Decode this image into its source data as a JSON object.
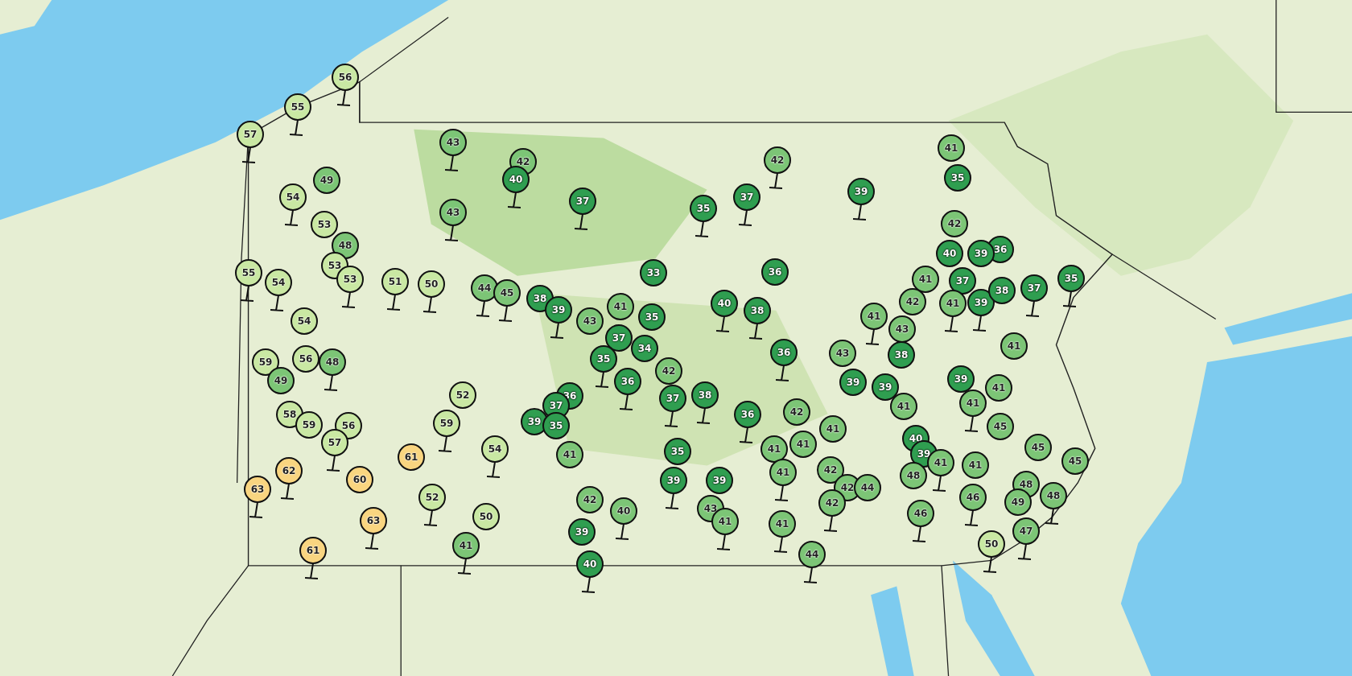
{
  "map": {
    "stations": [
      {
        "temperature": "56",
        "color": "#c9e8a3"
      },
      {
        "temperature": "55",
        "color": "#c9e8a3"
      },
      {
        "temperature": "57",
        "color": "#c9e8a3"
      },
      {
        "temperature": "43",
        "color": "#7cc576"
      },
      {
        "temperature": "42",
        "color": "#7cc576"
      },
      {
        "temperature": "40",
        "color": "#2f9e50"
      },
      {
        "temperature": "37",
        "color": "#2f9e50"
      },
      {
        "temperature": "49",
        "color": "#7cc576"
      },
      {
        "temperature": "54",
        "color": "#c9e8a3"
      },
      {
        "temperature": "43",
        "color": "#7cc576"
      },
      {
        "temperature": "53",
        "color": "#c9e8a3"
      },
      {
        "temperature": "48",
        "color": "#7cc576"
      },
      {
        "temperature": "53",
        "color": "#c9e8a3"
      },
      {
        "temperature": "53",
        "color": "#c9e8a3"
      },
      {
        "temperature": "55",
        "color": "#c9e8a3"
      },
      {
        "temperature": "54",
        "color": "#c9e8a3"
      },
      {
        "temperature": "51",
        "color": "#c9e8a3"
      },
      {
        "temperature": "50",
        "color": "#c9e8a3"
      },
      {
        "temperature": "44",
        "color": "#7cc576"
      },
      {
        "temperature": "45",
        "color": "#7cc576"
      },
      {
        "temperature": "38",
        "color": "#2f9e50"
      },
      {
        "temperature": "39",
        "color": "#2f9e50"
      },
      {
        "temperature": "54",
        "color": "#c9e8a3"
      },
      {
        "temperature": "59",
        "color": "#c9e8a3"
      },
      {
        "temperature": "56",
        "color": "#c9e8a3"
      },
      {
        "temperature": "48",
        "color": "#7cc576"
      },
      {
        "temperature": "49",
        "color": "#7cc576"
      },
      {
        "temperature": "52",
        "color": "#c9e8a3"
      },
      {
        "temperature": "59",
        "color": "#c9e8a3"
      },
      {
        "temperature": "58",
        "color": "#c9e8a3"
      },
      {
        "temperature": "59",
        "color": "#c9e8a3"
      },
      {
        "temperature": "56",
        "color": "#c9e8a3"
      },
      {
        "temperature": "57",
        "color": "#c9e8a3"
      },
      {
        "temperature": "61",
        "color": "#f9d580"
      },
      {
        "temperature": "54",
        "color": "#c9e8a3"
      },
      {
        "temperature": "62",
        "color": "#f9d580"
      },
      {
        "temperature": "63",
        "color": "#f9d580"
      },
      {
        "temperature": "60",
        "color": "#f9d580"
      },
      {
        "temperature": "52",
        "color": "#c9e8a3"
      },
      {
        "temperature": "50",
        "color": "#c9e8a3"
      },
      {
        "temperature": "63",
        "color": "#f9d580"
      },
      {
        "temperature": "41",
        "color": "#7cc576"
      },
      {
        "temperature": "61",
        "color": "#f9d580"
      },
      {
        "temperature": "35",
        "color": "#2f9e50"
      },
      {
        "temperature": "37",
        "color": "#2f9e50"
      },
      {
        "temperature": "42",
        "color": "#7cc576"
      },
      {
        "temperature": "39",
        "color": "#2f9e50"
      },
      {
        "temperature": "41",
        "color": "#7cc576"
      },
      {
        "temperature": "35",
        "color": "#2f9e50"
      },
      {
        "temperature": "42",
        "color": "#7cc576"
      },
      {
        "temperature": "36",
        "color": "#2f9e50"
      },
      {
        "temperature": "40",
        "color": "#2f9e50"
      },
      {
        "temperature": "39",
        "color": "#2f9e50"
      },
      {
        "temperature": "41",
        "color": "#7cc576"
      },
      {
        "temperature": "37",
        "color": "#2f9e50"
      },
      {
        "temperature": "41",
        "color": "#7cc576"
      },
      {
        "temperature": "39",
        "color": "#2f9e50"
      },
      {
        "temperature": "38",
        "color": "#2f9e50"
      },
      {
        "temperature": "37",
        "color": "#2f9e50"
      },
      {
        "temperature": "35",
        "color": "#2f9e50"
      },
      {
        "temperature": "33",
        "color": "#2f9e50"
      },
      {
        "temperature": "36",
        "color": "#2f9e50"
      },
      {
        "temperature": "43",
        "color": "#7cc576"
      },
      {
        "temperature": "41",
        "color": "#7cc576"
      },
      {
        "temperature": "35",
        "color": "#2f9e50"
      },
      {
        "temperature": "37",
        "color": "#2f9e50"
      },
      {
        "temperature": "34",
        "color": "#2f9e50"
      },
      {
        "temperature": "35",
        "color": "#2f9e50"
      },
      {
        "temperature": "36",
        "color": "#2f9e50"
      },
      {
        "temperature": "42",
        "color": "#7cc576"
      },
      {
        "temperature": "37",
        "color": "#2f9e50"
      },
      {
        "temperature": "38",
        "color": "#2f9e50"
      },
      {
        "temperature": "40",
        "color": "#2f9e50"
      },
      {
        "temperature": "38",
        "color": "#2f9e50"
      },
      {
        "temperature": "36",
        "color": "#2f9e50"
      },
      {
        "temperature": "43",
        "color": "#7cc576"
      },
      {
        "temperature": "41",
        "color": "#7cc576"
      },
      {
        "temperature": "42",
        "color": "#7cc576"
      },
      {
        "temperature": "43",
        "color": "#7cc576"
      },
      {
        "temperature": "38",
        "color": "#2f9e50"
      },
      {
        "temperature": "39",
        "color": "#2f9e50"
      },
      {
        "temperature": "39",
        "color": "#2f9e50"
      },
      {
        "temperature": "41",
        "color": "#7cc576"
      },
      {
        "temperature": "41",
        "color": "#7cc576"
      },
      {
        "temperature": "36",
        "color": "#2f9e50"
      },
      {
        "temperature": "37",
        "color": "#2f9e50"
      },
      {
        "temperature": "39",
        "color": "#2f9e50"
      },
      {
        "temperature": "35",
        "color": "#2f9e50"
      },
      {
        "temperature": "41",
        "color": "#7cc576"
      },
      {
        "temperature": "36",
        "color": "#2f9e50"
      },
      {
        "temperature": "42",
        "color": "#7cc576"
      },
      {
        "temperature": "41",
        "color": "#7cc576"
      },
      {
        "temperature": "41",
        "color": "#7cc576"
      },
      {
        "temperature": "41",
        "color": "#7cc576"
      },
      {
        "temperature": "41",
        "color": "#7cc576"
      },
      {
        "temperature": "42",
        "color": "#7cc576"
      },
      {
        "temperature": "42",
        "color": "#7cc576"
      },
      {
        "temperature": "44",
        "color": "#7cc576"
      },
      {
        "temperature": "42",
        "color": "#7cc576"
      },
      {
        "temperature": "35",
        "color": "#2f9e50"
      },
      {
        "temperature": "39",
        "color": "#2f9e50"
      },
      {
        "temperature": "39",
        "color": "#2f9e50"
      },
      {
        "temperature": "43",
        "color": "#7cc576"
      },
      {
        "temperature": "41",
        "color": "#7cc576"
      },
      {
        "temperature": "41",
        "color": "#7cc576"
      },
      {
        "temperature": "44",
        "color": "#7cc576"
      },
      {
        "temperature": "40",
        "color": "#7cc576"
      },
      {
        "temperature": "42",
        "color": "#7cc576"
      },
      {
        "temperature": "39",
        "color": "#2f9e50"
      },
      {
        "temperature": "40",
        "color": "#2f9e50"
      },
      {
        "temperature": "39",
        "color": "#2f9e50"
      },
      {
        "temperature": "41",
        "color": "#7cc576"
      },
      {
        "temperature": "41",
        "color": "#7cc576"
      },
      {
        "temperature": "45",
        "color": "#7cc576"
      },
      {
        "temperature": "45",
        "color": "#7cc576"
      },
      {
        "temperature": "45",
        "color": "#7cc576"
      },
      {
        "temperature": "40",
        "color": "#2f9e50"
      },
      {
        "temperature": "39",
        "color": "#2f9e50"
      },
      {
        "temperature": "41",
        "color": "#7cc576"
      },
      {
        "temperature": "41",
        "color": "#7cc576"
      },
      {
        "temperature": "48",
        "color": "#7cc576"
      },
      {
        "temperature": "48",
        "color": "#7cc576"
      },
      {
        "temperature": "49",
        "color": "#7cc576"
      },
      {
        "temperature": "46",
        "color": "#7cc576"
      },
      {
        "temperature": "48",
        "color": "#7cc576"
      },
      {
        "temperature": "46",
        "color": "#7cc576"
      },
      {
        "temperature": "47",
        "color": "#7cc576"
      },
      {
        "temperature": "50",
        "color": "#c9e8a3"
      }
    ]
  }
}
